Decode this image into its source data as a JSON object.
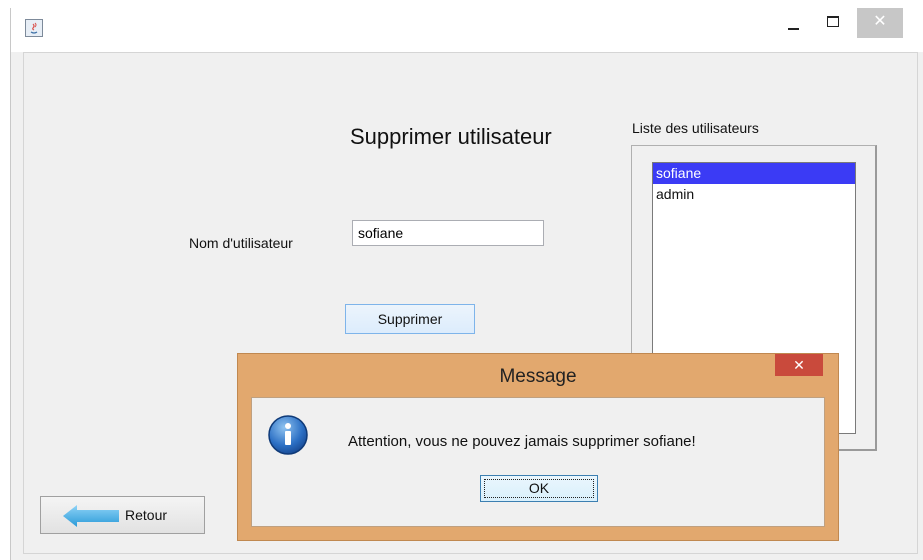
{
  "window": {
    "minimize_symbol": "",
    "close_symbol": "✕"
  },
  "form": {
    "title": "Supprimer utilisateur",
    "username_label": "Nom d'utilisateur",
    "username_value": "sofiane",
    "delete_label": "Supprimer"
  },
  "user_list": {
    "title": "Liste des utilisateurs",
    "items": [
      {
        "label": "sofiane",
        "selected": true
      },
      {
        "label": "admin",
        "selected": false
      }
    ]
  },
  "back_button": {
    "label": "Retour"
  },
  "dialog": {
    "title": "Message",
    "close_symbol": "✕",
    "message": "Attention, vous ne pouvez jamais supprimer sofiane!",
    "ok_label": "OK",
    "icon": "info-icon"
  },
  "colors": {
    "selection": "#3b3bf5",
    "dialog_frame": "#e2a86e",
    "dialog_close": "#c94a3c"
  }
}
